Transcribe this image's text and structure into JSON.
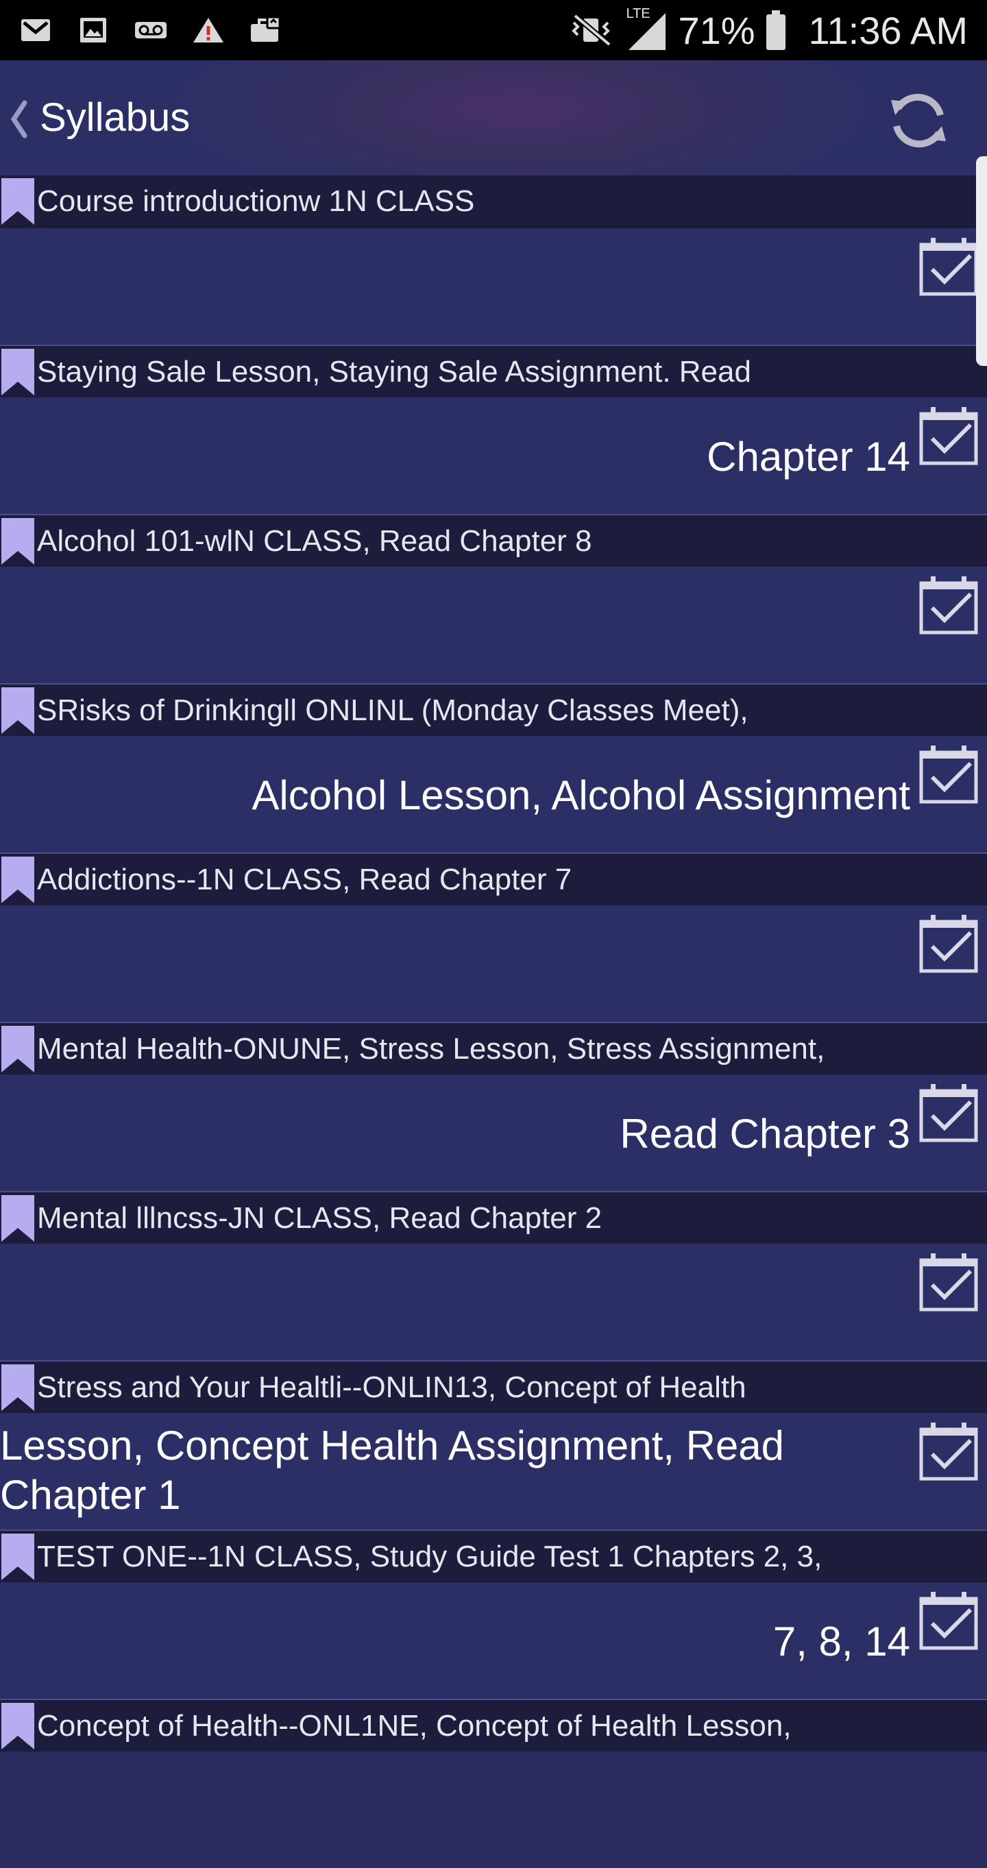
{
  "status_bar": {
    "battery": "71%",
    "time": "11:36 AM",
    "network": "LTE",
    "icons": [
      "gmail-icon",
      "photo-icon",
      "voicemail-icon",
      "warning-icon",
      "briefcase-icon",
      "mute-vibrate-icon",
      "signal-icon",
      "battery-icon"
    ]
  },
  "app_bar": {
    "title": "Syllabus",
    "icons": [
      "chevron-left-icon",
      "refresh-icon"
    ]
  },
  "items": [
    {
      "title": "Course introductionw 1N CLASS",
      "continuation": ""
    },
    {
      "title": "Staying Sale Lesson, Staying Sale Assignment. Read",
      "continuation": "Chapter 14"
    },
    {
      "title": "Alcohol 101-wlN CLASS, Read Chapter 8",
      "continuation": ""
    },
    {
      "title": "SRisks of Drinkingll ONLINL (Monday Classes Meet),",
      "continuation": "Alcohol Lesson, Alcohol Assignment"
    },
    {
      "title": "Addictions--1N CLASS, Read Chapter 7",
      "continuation": ""
    },
    {
      "title": "Mental Health-ONUNE, Stress Lesson, Stress Assignment,",
      "continuation": "Read Chapter 3"
    },
    {
      "title": "Mental lllncss-JN CLASS, Read Chapter 2",
      "continuation": ""
    },
    {
      "title": "Stress and Your Healtli--ONLIN13, Concept of Health",
      "continuation": "Lesson, Concept Health Assignment, Read Chapter 1"
    },
    {
      "title": "TEST ONE--1N CLASS, Study Guide Test 1 Chapters 2, 3,",
      "continuation": "7, 8, 14"
    },
    {
      "title": "Concept of Health--ONL1NE, Concept of Health Lesson,",
      "continuation": ""
    }
  ],
  "colors": {
    "background": "#2c2e66",
    "header_row": "#1d1c3c",
    "bookmark": "#b6acf0",
    "status_bar": "#000000",
    "divider": "#4c4f86"
  }
}
